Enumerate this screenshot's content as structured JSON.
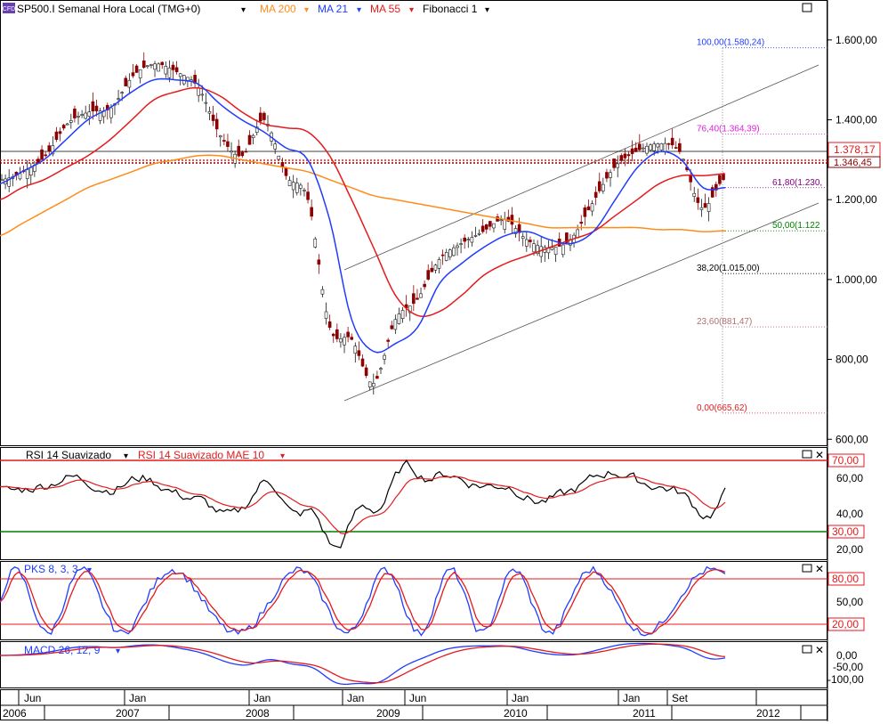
{
  "header": {
    "logo": "CFD",
    "symbol": "SP500.I Semanal Hora Local (TMG+0)",
    "ma200": "MA 200",
    "ma21": "MA 21",
    "ma55": "MA 55",
    "fib": "Fibonacci 1"
  },
  "colors": {
    "ma200": "#ff8c1a",
    "ma21": "#1f3cff",
    "ma55": "#e41a1c",
    "price_up": "#1a1a1a",
    "price_down": "#8b0000",
    "rsi": "#000000",
    "rsi_mae": "#e41a1c",
    "stoch_k": "#1f3cff",
    "stoch_d": "#e41a1c",
    "macd": "#1f3cff",
    "macd_signal": "#e41a1c"
  },
  "axis": {
    "price_ticks": [
      "600,00",
      "800,00",
      "1.000,00",
      "1.200,00",
      "1.400,00",
      "1.600,00"
    ],
    "price_ylim": [
      585,
      1700
    ],
    "last_price": "1.378,17",
    "prev_label": "1.346,45",
    "rsi_ticks": [
      "20,00",
      "40,00",
      "60,00"
    ],
    "rsi_levels": [
      "70,00",
      "30,00"
    ],
    "stoch_ticks": [
      "50,00"
    ],
    "stoch_levels": [
      "80,00",
      "20,00"
    ],
    "macd_ticks": [
      "0,00",
      "-50,00",
      "-100,00"
    ],
    "x_months": [
      "Jun",
      "Jan",
      "Jan",
      "Jan",
      "Jun",
      "Jan",
      "Jan",
      "Set"
    ],
    "x_years": [
      "2006",
      "2007",
      "2008",
      "2009",
      "2010",
      "2011",
      "2012"
    ]
  },
  "fibonacci": [
    {
      "label": "100,00(1.580,24)",
      "value": 1580.24,
      "color": "#1f3cff"
    },
    {
      "label": "76,40(1.364,39)",
      "value": 1364.39,
      "color": "#e020e0"
    },
    {
      "label": "61,80(1.230,",
      "value": 1230,
      "color": "#800080"
    },
    {
      "label": "50,00(1.122",
      "value": 1122,
      "color": "#008000"
    },
    {
      "label": "38,20(1.015,00)",
      "value": 1015,
      "color": "#000000"
    },
    {
      "label": "23,60(881,47)",
      "value": 881.47,
      "color": "#b07070"
    },
    {
      "label": "0,00(665,62)",
      "value": 665.62,
      "color": "#e41a1c"
    }
  ],
  "panels": {
    "rsi_title": "RSI 14 Suavizado",
    "rsi_mae_title": "RSI 14 Suavizado MAE 10",
    "stoch_title": "PKS 8, 3, 3",
    "macd_title": "MACD 26, 12, 9"
  },
  "chart_data": {
    "type": "line",
    "title": "SP500.I Semanal Hora Local (TMG+0)",
    "xlabel": "",
    "ylabel": "",
    "x": [
      "2006-05",
      "2006-07",
      "2006-09",
      "2006-11",
      "2007-01",
      "2007-03",
      "2007-05",
      "2007-07",
      "2007-09",
      "2007-11",
      "2008-01",
      "2008-03",
      "2008-05",
      "2008-07",
      "2008-09",
      "2008-11",
      "2009-01",
      "2009-03",
      "2009-05",
      "2009-07",
      "2009-09",
      "2009-11",
      "2010-01",
      "2010-03",
      "2010-05",
      "2010-07",
      "2010-09",
      "2010-11",
      "2011-01",
      "2011-03",
      "2011-05",
      "2011-07",
      "2011-09",
      "2011-11"
    ],
    "series": [
      {
        "name": "SP500.I",
        "values": [
          1250,
          1270,
          1310,
          1390,
          1420,
          1430,
          1510,
          1540,
          1520,
          1480,
          1360,
          1310,
          1400,
          1260,
          1200,
          880,
          850,
          740,
          900,
          950,
          1050,
          1090,
          1120,
          1150,
          1100,
          1080,
          1100,
          1190,
          1280,
          1320,
          1340,
          1320,
          1180,
          1250
        ]
      },
      {
        "name": "MA 200",
        "values": [
          1110,
          1140,
          1170,
          1200,
          1230,
          1250,
          1270,
          1290,
          1300,
          1310,
          1310,
          1300,
          1290,
          1280,
          1270,
          1250,
          1230,
          1210,
          1200,
          1190,
          1180,
          1170,
          1160,
          1150,
          1140,
          1130,
          1130,
          1130,
          1130,
          1130,
          1125,
          1125,
          1120,
          1122
        ]
      },
      {
        "name": "MA 21",
        "values": [
          1240,
          1270,
          1300,
          1350,
          1400,
          1430,
          1470,
          1500,
          1500,
          1490,
          1440,
          1400,
          1370,
          1330,
          1300,
          1150,
          900,
          820,
          840,
          880,
          990,
          1040,
          1080,
          1110,
          1120,
          1100,
          1090,
          1120,
          1200,
          1280,
          1320,
          1300,
          1230,
          1230
        ]
      },
      {
        "name": "MA 55",
        "values": [
          1200,
          1230,
          1250,
          1280,
          1310,
          1350,
          1400,
          1450,
          1470,
          1480,
          1460,
          1420,
          1390,
          1380,
          1370,
          1310,
          1200,
          1080,
          960,
          910,
          920,
          960,
          1010,
          1040,
          1060,
          1080,
          1100,
          1120,
          1160,
          1200,
          1240,
          1260,
          1260,
          1265
        ]
      }
    ],
    "ylim": [
      585,
      1700
    ]
  }
}
